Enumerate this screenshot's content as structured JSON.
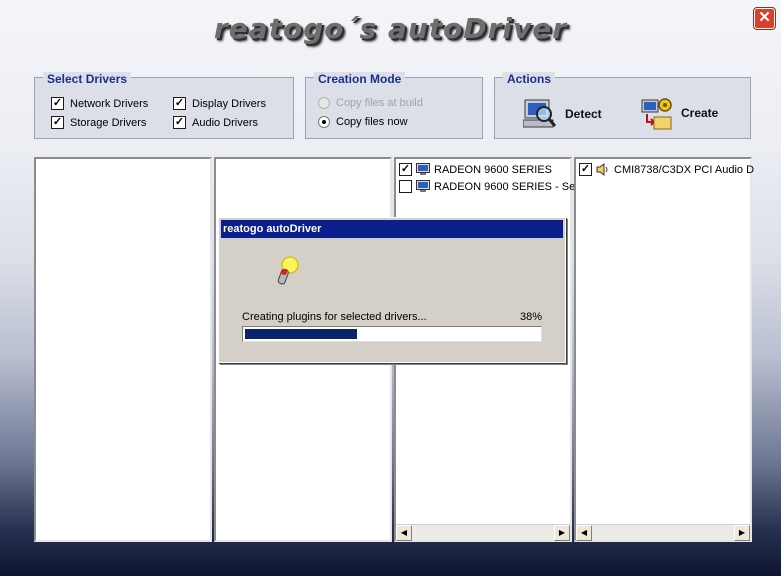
{
  "app": {
    "title": "reatogo´s autoDriver",
    "close_glyph": "✕"
  },
  "select_drivers": {
    "legend": "Select Drivers",
    "items": [
      {
        "label": "Network Drivers",
        "checked": true
      },
      {
        "label": "Display Drivers",
        "checked": true
      },
      {
        "label": "Storage Drivers",
        "checked": true
      },
      {
        "label": "Audio Drivers",
        "checked": true
      }
    ]
  },
  "creation_mode": {
    "legend": "Creation Mode",
    "options": [
      {
        "label": "Copy files at build",
        "selected": false,
        "disabled": true
      },
      {
        "label": "Copy files now",
        "selected": true,
        "disabled": false
      }
    ]
  },
  "actions": {
    "legend": "Actions",
    "detect_label": "Detect",
    "create_label": "Create",
    "detect_icon": "magnifier-computer-icon",
    "create_icon": "gear-folder-icon"
  },
  "lists": {
    "display": [
      {
        "label": "RADEON 9600 SERIES",
        "checked": true
      },
      {
        "label": "RADEON 9600 SERIES - Se",
        "checked": false
      }
    ],
    "audio": [
      {
        "label": "CMI8738/C3DX PCI Audio D",
        "checked": true
      }
    ]
  },
  "dialog": {
    "title": "reatogo autoDriver",
    "message": "Creating plugins for selected drivers...",
    "percent_label": "38%",
    "progress": 0.38
  },
  "colors": {
    "legend_text": "#1a2f8f",
    "dialog_titlebar": "#0a1e8c",
    "progress_fill": "#0a246a",
    "close_button": "#d7412c"
  }
}
